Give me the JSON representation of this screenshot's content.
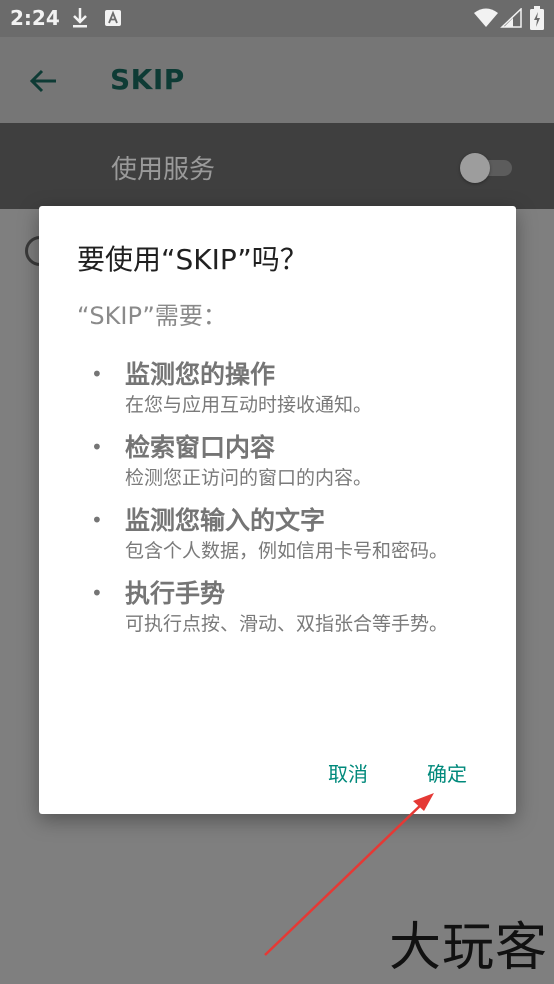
{
  "status_bar": {
    "time": "2:24",
    "icons": [
      "download-icon",
      "a-icon",
      "wifi-icon",
      "signal-icon",
      "battery-icon"
    ]
  },
  "app_bar": {
    "title": "SKIP",
    "back_icon": "arrow-back-icon"
  },
  "service_row": {
    "label": "使用服务",
    "toggle_state": "off"
  },
  "dialog": {
    "title": "要使用“SKIP”吗？",
    "subtitle": "“SKIP”需要：",
    "permissions": [
      {
        "title": "监测您的操作",
        "description": "在您与应用互动时接收通知。"
      },
      {
        "title": "检索窗口内容",
        "description": "检测您正访问的窗口的内容。"
      },
      {
        "title": "监测您输入的文字",
        "description": "包含个人数据，例如信用卡号和密码。"
      },
      {
        "title": "执行手势",
        "description": "可执行点按、滑动、双指张合等手势。"
      }
    ],
    "bullet": "•",
    "cancel_label": "取消",
    "confirm_label": "确定"
  },
  "watermark": "大玩客",
  "colors": {
    "accent": "#00897b",
    "annotation": "#e53935",
    "scrim": "#7f7f7f",
    "app_title": "#0e3b35"
  }
}
